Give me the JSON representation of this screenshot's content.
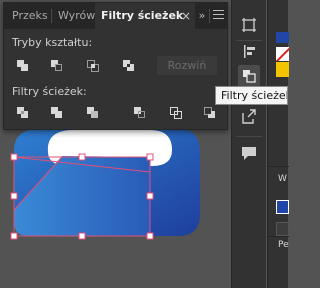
{
  "panel": {
    "tabs": [
      {
        "label": "Przeks",
        "active": false
      },
      {
        "label": "Wyrów",
        "active": false
      },
      {
        "label": "Filtry ścieżek",
        "active": true
      }
    ],
    "close_glyph": "×",
    "collapse_glyph": "»",
    "shape_modes_label": "Tryby kształtu:",
    "expand_label": "Rozwiń",
    "pathfinders_label": "Filtry ścieżek:",
    "shape_mode_buttons": [
      "unite-icon",
      "minus-front-icon",
      "intersect-icon",
      "exclude-icon"
    ],
    "pathfinder_buttons": [
      "divide-icon",
      "trim-icon",
      "merge-icon",
      "crop-icon",
      "outline-icon",
      "minus-back-icon"
    ]
  },
  "tooltip": {
    "text": "Filtry ścieżek"
  },
  "toolstrip": {
    "tools": [
      "artboards-icon",
      "align-icon",
      "pathfinder-icon",
      "export-icon",
      "comment-icon"
    ]
  },
  "rightpane": {
    "labels": [
      "W",
      "Pe"
    ],
    "colors": {
      "fill": "#2046a8",
      "yellow": "#f3c500",
      "selection": "#e0507a"
    }
  }
}
